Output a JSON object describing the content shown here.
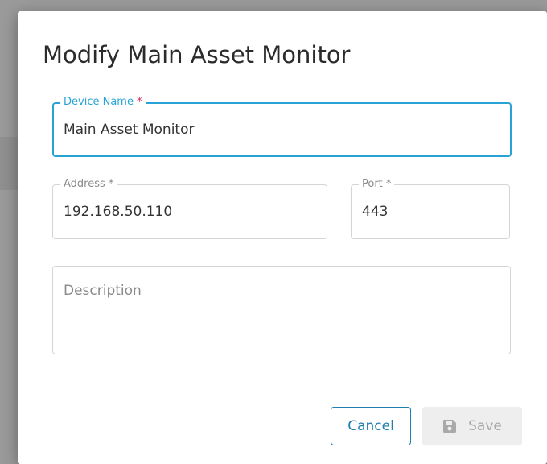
{
  "dialog": {
    "title": "Modify Main Asset Monitor",
    "fields": {
      "device_name": {
        "label": "Device Name",
        "required_mark": "*",
        "value": "Main Asset Monitor"
      },
      "address": {
        "label": "Address",
        "required_mark": "*",
        "value": "192.168.50.110"
      },
      "port": {
        "label": "Port",
        "required_mark": "*",
        "value": "443"
      },
      "description": {
        "placeholder": "Description",
        "value": ""
      }
    },
    "buttons": {
      "cancel_label": "Cancel",
      "save_label": "Save",
      "save_icon": "floppy-disk-icon"
    }
  },
  "colors": {
    "accent": "#29a3d6",
    "required": "#e0245e",
    "primary_button": "#1e7fb0",
    "disabled_bg": "#eeeeee",
    "disabled_text": "#a9a9a9",
    "overlay": "#9a9a9a"
  }
}
